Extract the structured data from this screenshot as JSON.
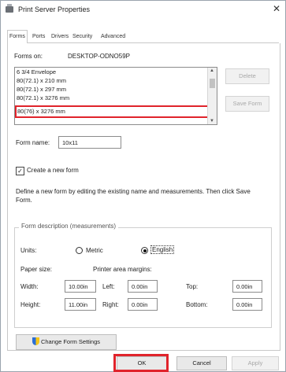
{
  "window": {
    "title": "Print Server Properties",
    "close_glyph": "✕"
  },
  "tabs": [
    "Forms",
    "Ports",
    "Drivers",
    "Security",
    "Advanced"
  ],
  "forms_on": {
    "label": "Forms on:",
    "server": "DESKTOP-ODNO59P"
  },
  "forms_list": {
    "items": [
      "6 3/4 Envelope",
      "80(72.1) x 210 mm",
      "80(72.1) x 297 mm",
      "80(72.1) x 3276 mm",
      "80(76) x 3276 mm"
    ],
    "selected_index": 4
  },
  "buttons": {
    "delete": "Delete",
    "save_form": "Save Form",
    "change_form_settings": "Change Form Settings",
    "ok": "OK",
    "cancel": "Cancel",
    "apply": "Apply"
  },
  "form_name": {
    "label": "Form name:",
    "value": "10x11"
  },
  "create_new": {
    "label": "Create a new form",
    "checked": true,
    "check_glyph": "✓"
  },
  "help_text": "Define a new form by editing the existing name and measurements. Then click Save Form.",
  "group": {
    "title": "Form description (measurements)",
    "units_label": "Units:",
    "metric": "Metric",
    "english": "English",
    "selected_unit": "English",
    "paper_size_label": "Paper size:",
    "printer_margins_label": "Printer area margins:",
    "width_label": "Width:",
    "height_label": "Height:",
    "width": "10.00in",
    "height": "11.00in",
    "left_label": "Left:",
    "right_label": "Right:",
    "top_label": "Top:",
    "bottom_label": "Bottom:",
    "left": "0.00in",
    "right": "0.00in",
    "top": "0.00in",
    "bottom": "0.00in"
  },
  "colors": {
    "highlight": "#e0232b"
  }
}
